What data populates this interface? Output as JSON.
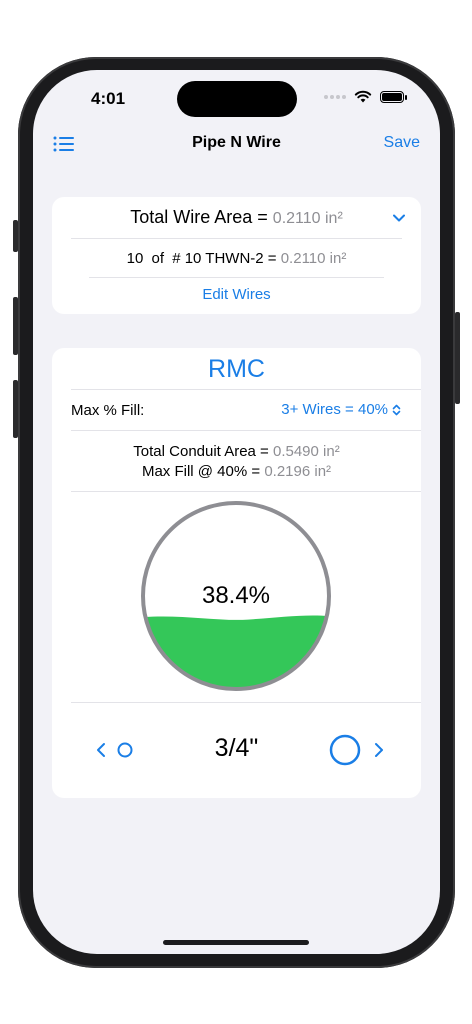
{
  "status": {
    "time": "4:01"
  },
  "nav": {
    "title": "Pipe N Wire",
    "save": "Save",
    "menu_icon": "list-icon"
  },
  "wire_summary": {
    "total_label": "Total Wire Area =",
    "total_value": "0.2110 in²",
    "item_count": "10",
    "item_of": "of",
    "item_wire": "# 10 THWN-2 =",
    "item_value": "0.2110 in²",
    "edit_label": "Edit Wires"
  },
  "conduit": {
    "type": "RMC",
    "max_fill_label": "Max % Fill:",
    "max_fill_selection": "3+ Wires = 40%",
    "total_area_label": "Total Conduit Area =",
    "total_area_value": "0.5490 in²",
    "max_fill_at_label": "Max Fill @ 40% =",
    "max_fill_at_value": "0.2196 in²",
    "fill_percent_text": "38.4%",
    "fill_level": 0.384,
    "size": "3/4\""
  },
  "colors": {
    "accent": "#1a7ee6",
    "fill_green": "#34c759",
    "ring_gray": "#8e8e93"
  }
}
